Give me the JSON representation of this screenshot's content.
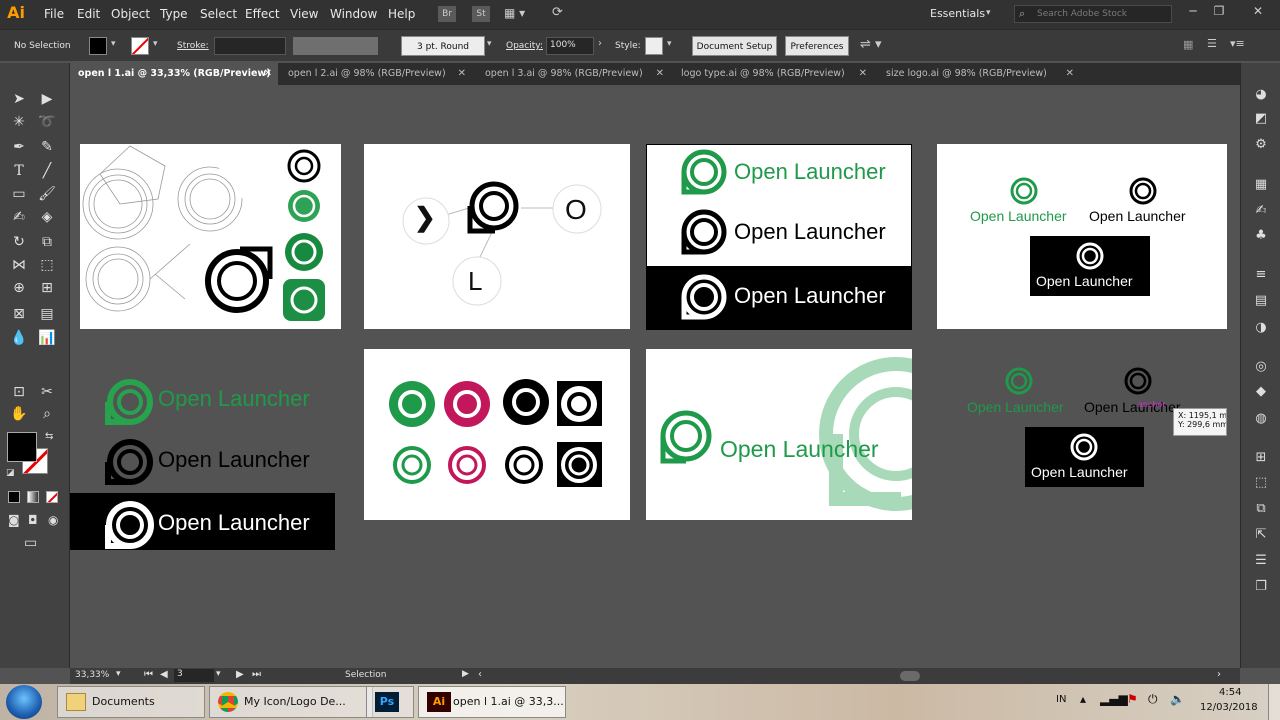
{
  "app": {
    "logo": "Ai",
    "menus": [
      "File",
      "Edit",
      "Object",
      "Type",
      "Select",
      "Effect",
      "View",
      "Window",
      "Help"
    ],
    "workspace": "Essentials",
    "search_placeholder": "Search Adobe Stock",
    "icons": {
      "br": "Br",
      "st": "St"
    }
  },
  "control": {
    "selection": "No Selection",
    "stroke_label": "Stroke:",
    "brush": "3 pt. Round",
    "opacity_label": "Opacity:",
    "opacity_value": "100%",
    "style_label": "Style:",
    "doc_setup": "Document Setup",
    "preferences": "Preferences"
  },
  "tabs": [
    {
      "label": "open l 1.ai @ 33,33% (RGB/Preview)",
      "active": true
    },
    {
      "label": "open l 2.ai @ 98% (RGB/Preview)",
      "active": false
    },
    {
      "label": "open l 3.ai @ 98% (RGB/Preview)",
      "active": false
    },
    {
      "label": "logo type.ai @ 98% (RGB/Preview)",
      "active": false
    },
    {
      "label": "size logo.ai @ 98% (RGB/Preview)",
      "active": false
    }
  ],
  "artboards": {
    "flow": {
      "n1": "❯",
      "n2": "O",
      "n3": "L"
    },
    "brand": "Open Launcher"
  },
  "tooltip": {
    "x": "X: 1195,1 m",
    "y": "Y: 299,6 mm",
    "anchor": "anchor"
  },
  "status": {
    "zoom": "33,33%",
    "page": "3",
    "mode": "Selection"
  },
  "taskbar": {
    "items": [
      "Documents",
      "My Icon/Logo De...",
      "",
      "open l 1.ai @ 33,3..."
    ],
    "ps_label": "Ps",
    "ai_label": "Ai",
    "lang": "IN",
    "time": "4:54",
    "date": "12/03/2018"
  },
  "colors": {
    "brand_green": "#1f9a4a",
    "magenta": "#c2185b",
    "ai_orange": "#ff9a00"
  }
}
